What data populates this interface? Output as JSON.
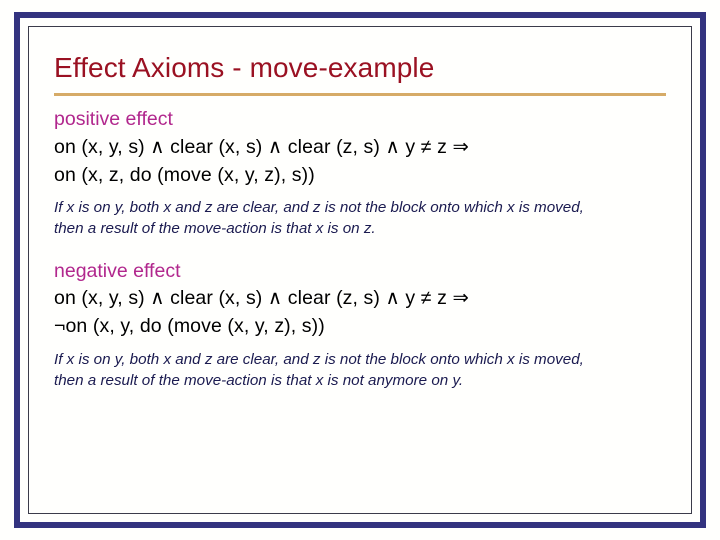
{
  "slide": {
    "title": "Effect Axioms - move-example",
    "colors": {
      "title": "#9a1122",
      "heading": "#b1278d",
      "formula": "#000000",
      "explanation": "#1b1b50",
      "frame_border": "#33337f",
      "inner_border": "#3b3b4a",
      "rule": "#d6ab67",
      "background": "#fffffd"
    },
    "positive": {
      "heading": "positive effect",
      "formula_line_1": "on (x, y, s) ∧ clear (x, s) ∧ clear (z, s) ∧ y ≠ z ⇒",
      "formula_line_2": "on (x, z, do (move (x, y, z), s))",
      "explanation": "If x is on y, both x and z are clear, and z is not the block onto which x is moved, then a result of the move-action is that x is on z."
    },
    "negative": {
      "heading": "negative effect",
      "formula_line_1": "on (x, y, s) ∧ clear (x, s) ∧ clear (z, s) ∧ y ≠ z ⇒",
      "formula_line_2": "¬on (x, y, do (move (x, y, z), s))",
      "explanation": "If x is on y, both x and z are clear, and z is not the block onto which x is moved, then a result of the move-action is that x is not anymore on y."
    }
  }
}
